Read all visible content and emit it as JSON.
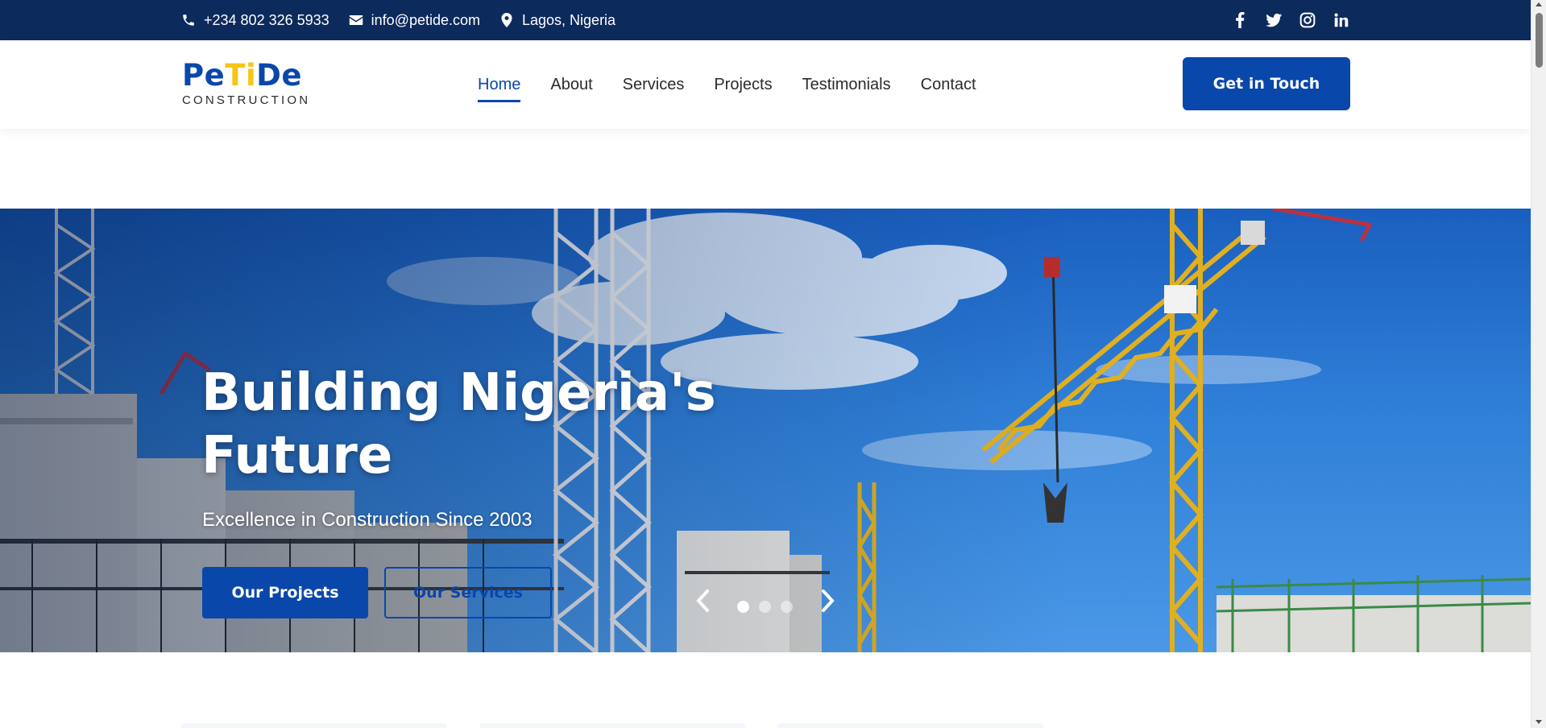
{
  "topbar": {
    "phone": "+234 802 326 5933",
    "email": "info@petide.com",
    "location": "Lagos, Nigeria",
    "icons": [
      "phone-icon",
      "mail-icon",
      "location-pin-icon"
    ],
    "social": [
      "facebook-icon",
      "twitter-icon",
      "instagram-icon",
      "linkedin-icon"
    ]
  },
  "logo": {
    "part1": "Pe",
    "part2": "Ti",
    "part3": "De",
    "subtitle": "CONSTRUCTION"
  },
  "nav": {
    "items": [
      "Home",
      "About",
      "Services",
      "Projects",
      "Testimonials",
      "Contact"
    ],
    "active": "Home",
    "cta": "Get in Touch"
  },
  "hero": {
    "title": "Building Nigeria's Future",
    "tagline": "Excellence in Construction Since 2003",
    "primary_button": "Our Projects",
    "secondary_button": "Our Services",
    "slides": 3,
    "active_slide": 1
  },
  "colors": {
    "topbar": "#0d2a5c",
    "brand_blue": "#0a47ab",
    "brand_yellow": "#f5c518"
  }
}
